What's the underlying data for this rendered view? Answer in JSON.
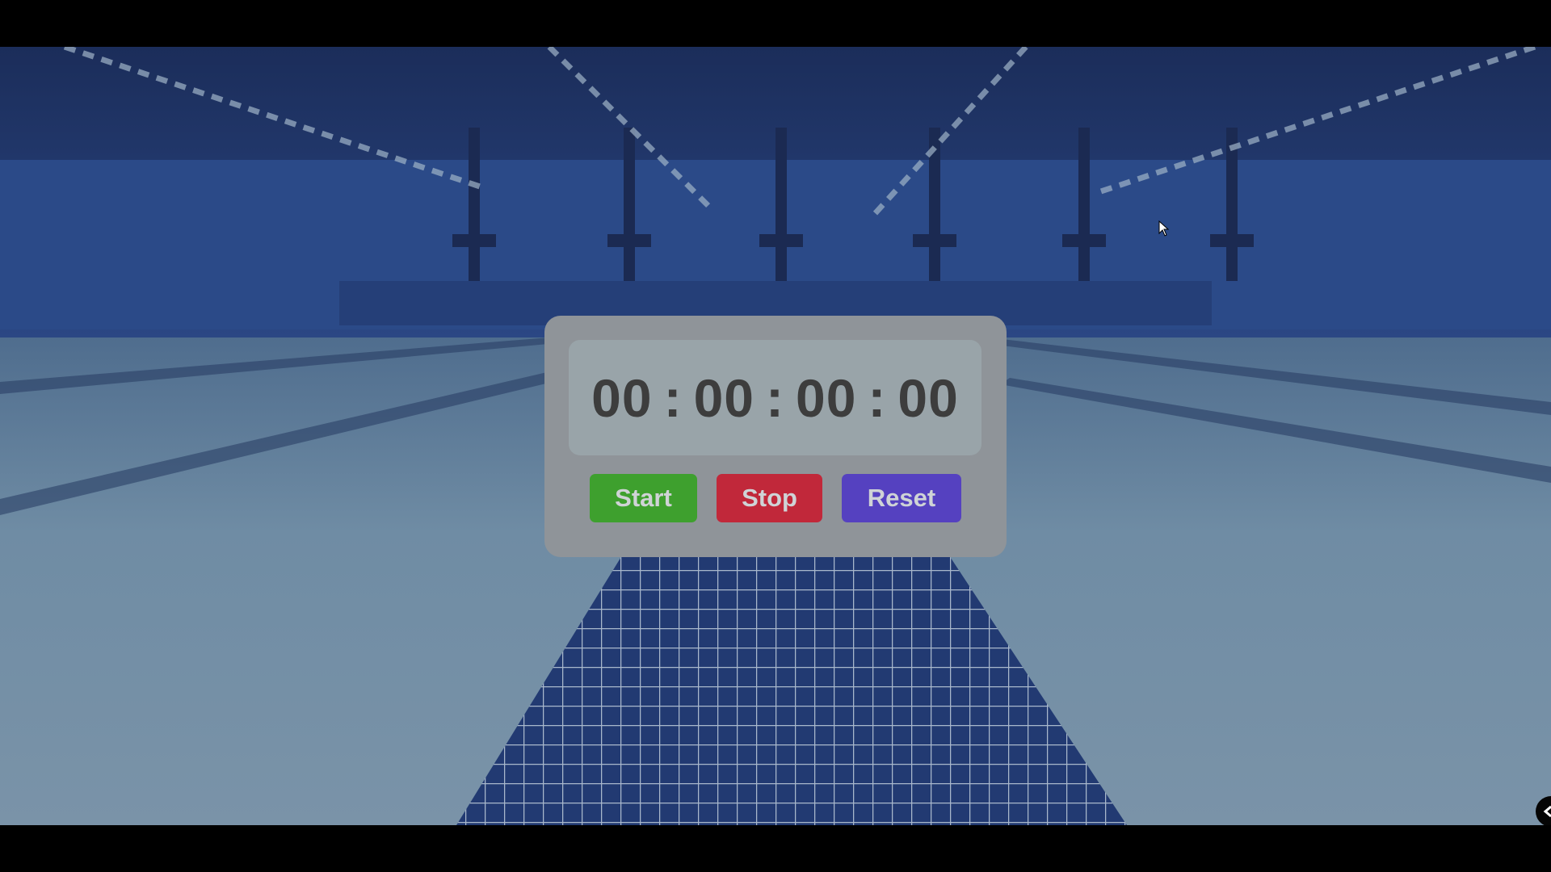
{
  "timer": {
    "hours": "00",
    "minutes": "00",
    "seconds": "00",
    "centiseconds": "00",
    "separator": ":"
  },
  "buttons": {
    "start_label": "Start",
    "stop_label": "Stop",
    "reset_label": "Reset"
  },
  "colors": {
    "start": "#3ea02e",
    "stop": "#c1283a",
    "reset": "#5541c0",
    "panel": "#8f9499",
    "display": "#99a4a9"
  },
  "icons": {
    "cursor": "mouse-pointer-icon",
    "side_toggle": "chevron-left-icon"
  }
}
